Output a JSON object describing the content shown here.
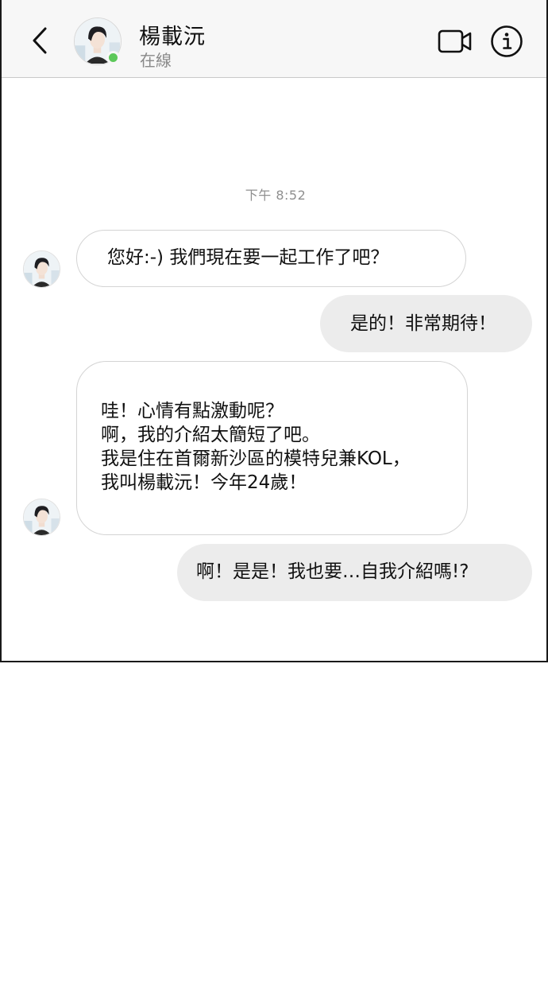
{
  "header": {
    "contact_name": "楊載沅",
    "status": "在線"
  },
  "chat": {
    "timestamp": "下午 8:52",
    "messages": [
      {
        "direction": "incoming",
        "lines": [
          "您好:-) 我們現在要一起工作了吧？"
        ]
      },
      {
        "direction": "outgoing",
        "lines": [
          "是的！非常期待！"
        ]
      },
      {
        "direction": "incoming",
        "lines": [
          "哇！心情有點激動呢？",
          "啊，我的介紹太簡短了吧。",
          "我是住在首爾新沙區的模特兒兼KOL，",
          "我叫楊載沅！今年24歲！"
        ]
      },
      {
        "direction": "outgoing",
        "lines": [
          "啊！是是！我也要…自我介紹嗎!?"
        ]
      }
    ]
  },
  "colors": {
    "online": "#5cc85a",
    "outgoing_bubble": "#ececec",
    "incoming_border": "#d4d4d4",
    "header_bg": "#f7f7f7"
  },
  "icons": [
    "back-arrow-icon",
    "video-call-icon",
    "info-icon"
  ]
}
